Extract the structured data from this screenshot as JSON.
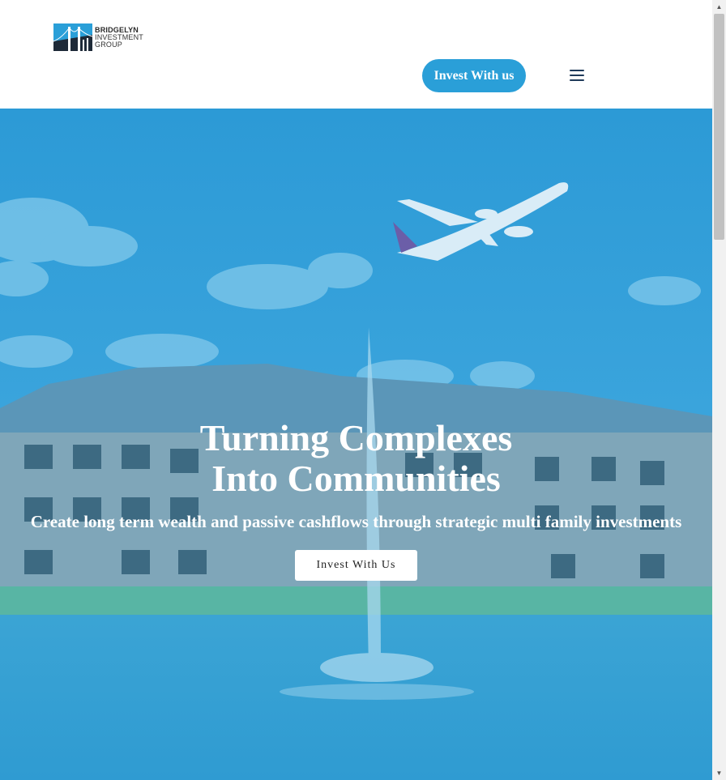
{
  "header": {
    "logo": {
      "line1": "BRIDGELYN",
      "line2": "INVESTMENT",
      "line3": "GROUP",
      "icon": "bridge-icon"
    },
    "cta_label": "Invest With us",
    "menu_icon": "hamburger-menu-icon"
  },
  "hero": {
    "title_line1": "Turning Complexes",
    "title_line2": "Into Communities",
    "subtitle": "Create long term wealth and passive cashflows through strategic multi family investments",
    "button_label": "Invest With Us"
  },
  "colors": {
    "accent": "#2a9fd8",
    "overlay": "#2f9fd6",
    "menu_icon": "#1f3a5a"
  }
}
